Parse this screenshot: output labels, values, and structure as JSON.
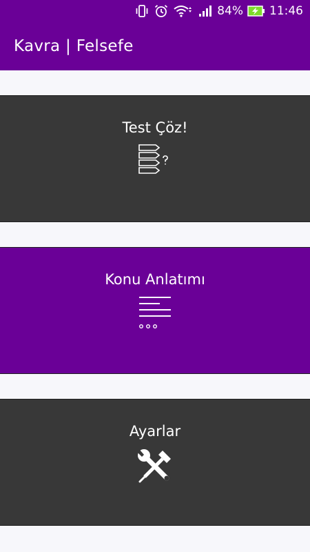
{
  "status_bar": {
    "battery_percent": "84%",
    "time": "11:46",
    "icons": [
      "vibrate-icon",
      "alarm-icon",
      "wifi-icon",
      "signal-icon",
      "battery-charging-icon"
    ]
  },
  "app_bar": {
    "title": "Kavra | Felsefe"
  },
  "menu": [
    {
      "label": "Test Çöz!",
      "icon": "quiz-list-icon"
    },
    {
      "label": "Konu Anlatımı",
      "icon": "text-lines-icon"
    },
    {
      "label": "Ayarlar",
      "icon": "wrench-screwdriver-icon"
    }
  ],
  "colors": {
    "primary": "#6a0097",
    "card_dark": "#383838",
    "background": "#f7f7fb",
    "battery_green": "#7ddc2b"
  }
}
